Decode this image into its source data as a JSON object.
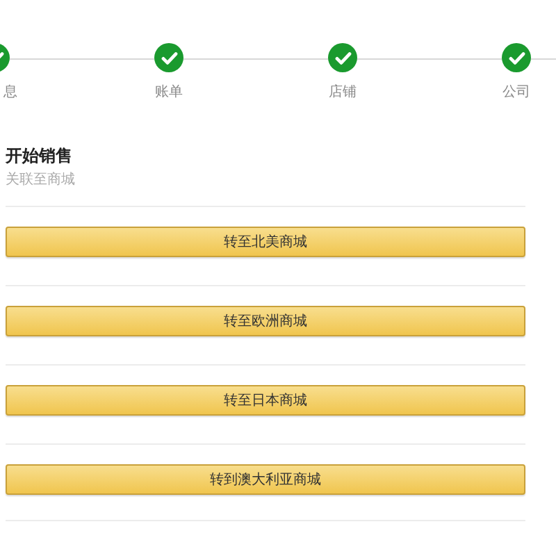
{
  "steps": [
    {
      "label": "息",
      "done": true
    },
    {
      "label": "账单",
      "done": true
    },
    {
      "label": "店铺",
      "done": true
    },
    {
      "label": "公司",
      "done": true
    }
  ],
  "section": {
    "title": "开始销售",
    "subtitle": "关联至商城"
  },
  "buttons": [
    "转至北美商城",
    "转至欧洲商城",
    "转至日本商城",
    "转到澳大利亚商城"
  ]
}
